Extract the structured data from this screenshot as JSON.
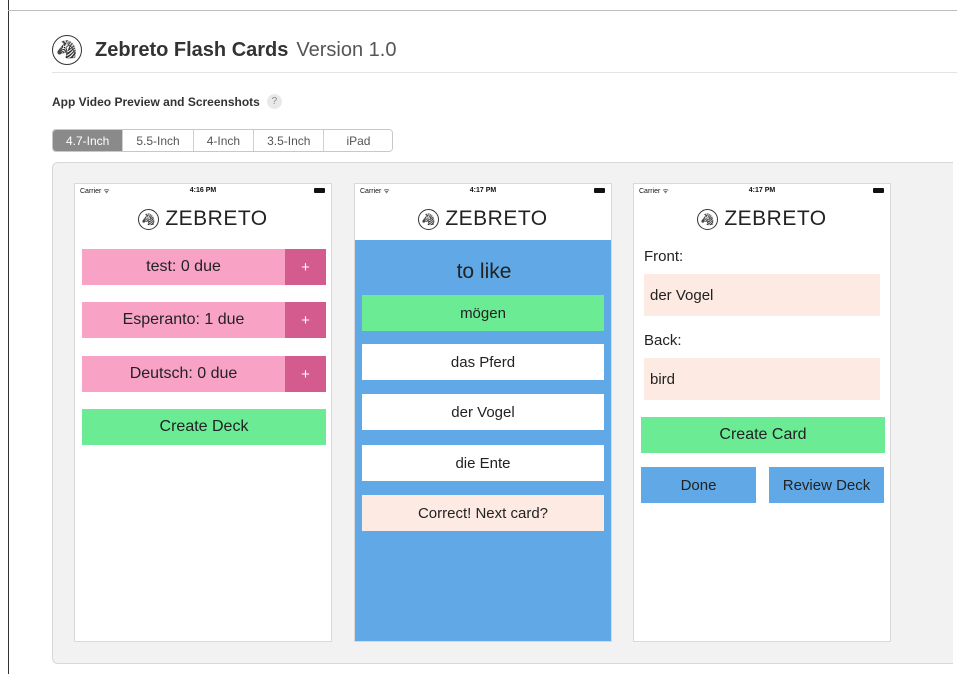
{
  "header": {
    "title": "Zebreto Flash Cards",
    "version": "Version 1.0",
    "logo_icon": "zebra-logo-icon"
  },
  "section": {
    "label": "App Video Preview and Screenshots",
    "help": "?"
  },
  "device_tabs": {
    "items": [
      {
        "label": "4.7-Inch",
        "active": true
      },
      {
        "label": "5.5-Inch",
        "active": false
      },
      {
        "label": "4-Inch",
        "active": false
      },
      {
        "label": "3.5-Inch",
        "active": false
      },
      {
        "label": "iPad",
        "active": false
      }
    ]
  },
  "screens": [
    {
      "status": {
        "carrier": "Carrier ᯤ",
        "time": "4:16 PM"
      },
      "brand": "ZEBRETO",
      "decks": [
        {
          "label": "test: 0 due",
          "plus": "+"
        },
        {
          "label": "Esperanto: 1 due",
          "plus": "+"
        },
        {
          "label": "Deutsch: 0 due",
          "plus": "+"
        }
      ],
      "create_deck": "Create Deck"
    },
    {
      "status": {
        "carrier": "Carrier ᯤ",
        "time": "4:17 PM"
      },
      "brand": "ZEBRETO",
      "question": "to like",
      "answers": [
        "mögen",
        "das Pferd",
        "der Vogel",
        "die Ente"
      ],
      "feedback": "Correct! Next card?"
    },
    {
      "status": {
        "carrier": "Carrier ᯤ",
        "time": "4:17 PM"
      },
      "brand": "ZEBRETO",
      "front_label": "Front:",
      "front_value": "der Vogel",
      "back_label": "Back:",
      "back_value": "bird",
      "create_card": "Create Card",
      "done": "Done",
      "review_deck": "Review Deck"
    }
  ],
  "colors": {
    "pink": "#f8a3c6",
    "pink_dark": "#d45b8e",
    "green": "#6aeb94",
    "blue": "#60a9e6",
    "peach": "#fdeae2",
    "tab_active": "#8a8a8a"
  }
}
